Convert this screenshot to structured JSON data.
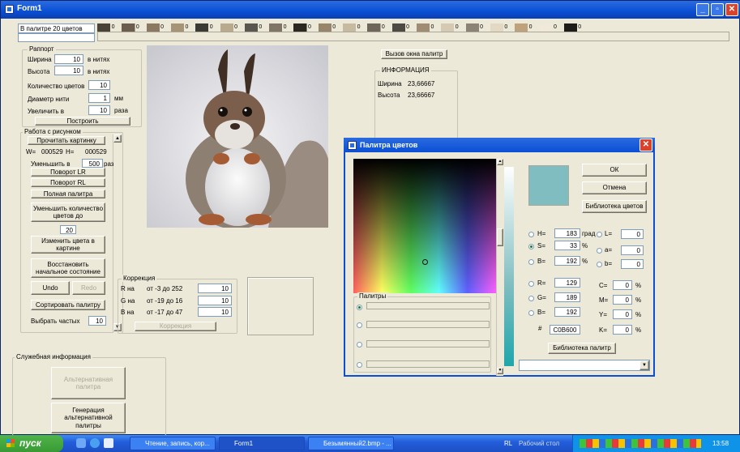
{
  "window": {
    "title": "Form1"
  },
  "top": {
    "palette_label": "В палитре 20 цветов",
    "swatches": [
      {
        "c": "#4a4237",
        "t": "0"
      },
      {
        "c": "#6b5e4e",
        "t": "0"
      },
      {
        "c": "#8a7863",
        "t": "0"
      },
      {
        "c": "#a79476",
        "t": "0"
      },
      {
        "c": "#3c3a35",
        "t": "0"
      },
      {
        "c": "#b9a98d",
        "t": "0"
      },
      {
        "c": "#5a5650",
        "t": "0"
      },
      {
        "c": "#7e7567",
        "t": "0"
      },
      {
        "c": "#2b2822",
        "t": "0"
      },
      {
        "c": "#97846a",
        "t": "0"
      },
      {
        "c": "#c8baa0",
        "t": "0"
      },
      {
        "c": "#6e665b",
        "t": "0"
      },
      {
        "c": "#4d4a44",
        "t": "0"
      },
      {
        "c": "#a08c72",
        "t": "0"
      },
      {
        "c": "#d5c9b3",
        "t": "0"
      },
      {
        "c": "#8b8376",
        "t": "0"
      },
      {
        "c": "#e2d8c4",
        "t": "0"
      },
      {
        "c": "#bfa27c",
        "t": "0"
      },
      {
        "c": "#f0e9da",
        "t": "0"
      },
      {
        "c": "#1f1d1a",
        "t": "0"
      }
    ]
  },
  "rapport": {
    "title": "Раппорт",
    "width_label": "Ширина",
    "width_value": "10",
    "width_unit": "в нитях",
    "height_label": "Высота",
    "height_value": "10",
    "height_unit": "в нитях",
    "colors_label": "Количество цветов",
    "colors_value": "10",
    "diam_label": "Диаметр нити",
    "diam_value": "1",
    "diam_unit": "мм",
    "scale_label": "Увеличить в",
    "scale_value": "10",
    "scale_unit": "раза",
    "build_button": "Построить"
  },
  "work": {
    "title": "Работа с рисунком",
    "read_button": "Прочитать картинку",
    "w_label": "W=",
    "w_value": "000529",
    "h_label": "H=",
    "h_value": "000529",
    "reduce_label": "Уменьшить в",
    "reduce_value": "500",
    "reduce_unit": "раз",
    "rot_lr": "Поворот LR",
    "rot_rl": "Поворот RL",
    "full_palette": "Полная палитра",
    "reduce_colors": "Уменьшить количество цветов до",
    "reduce_colors_value": "20",
    "change_colors": "Изменить цвета в картине",
    "restore": "Восстановить начальное состояние",
    "undo": "Undo",
    "redo": "Redo",
    "sort": "Сортировать палитру",
    "select_label": "Выбрать частых",
    "select_value": "10"
  },
  "palette_call_button": "Вызов окна палитр",
  "info": {
    "title": "ИНФОРМАЦИЯ",
    "width_label": "Ширина",
    "width_value": "23,66667",
    "height_label": "Высота",
    "height_value": "23,66667"
  },
  "correction": {
    "title": "Коррекция",
    "r_label": "R на",
    "r_range": "от -3 до  252",
    "r_value": "10",
    "g_label": "G на",
    "g_range": "от -19 до  16",
    "g_value": "10",
    "b_label": "B на",
    "b_range": "от -17 до  47",
    "b_value": "10",
    "button": "Коррекция"
  },
  "service": {
    "title": "Служебная информация",
    "alt_palette": "Альтернативная палитра",
    "gen_palette": "Генерация альтернативной палитры"
  },
  "dialog": {
    "title": "Палитра цветов",
    "ok": "ОК",
    "cancel": "Отмена",
    "color_lib": "Библиотека цветов",
    "palette_lib": "Библиотека палитр",
    "palettes_title": "Палитры",
    "h_label": "H=",
    "h_value": "183",
    "h_unit": "град",
    "s_label": "S=",
    "s_value": "33",
    "s_unit": "%",
    "b_label": "B=",
    "b_value": "192",
    "b_unit": "%",
    "r_label": "R=",
    "r_value": "129",
    "g_label": "G=",
    "g_value": "189",
    "bb_label": "B=",
    "bb_value": "192",
    "hex_label": "#",
    "hex_value": "C0B600",
    "l_label": "L=",
    "l_value": "0",
    "a_label": "a=",
    "a_value": "0",
    "lb_label": "b=",
    "lb_value": "0",
    "c_label": "C=",
    "c_value": "0",
    "m_label": "M=",
    "m_value": "0",
    "y_label": "Y=",
    "y_value": "0",
    "k_label": "K=",
    "k_value": "0",
    "pct": "%",
    "preview_color": "#7fbdc0"
  },
  "taskbar": {
    "start": "пуск",
    "tasks": [
      "Чтение, запись, кор...",
      "Form1",
      "Безымянный2.bmp - ..."
    ],
    "rl": "RL",
    "desktop": "Рабочий стол",
    "clock": "13:58",
    "left_tab": "orm"
  }
}
